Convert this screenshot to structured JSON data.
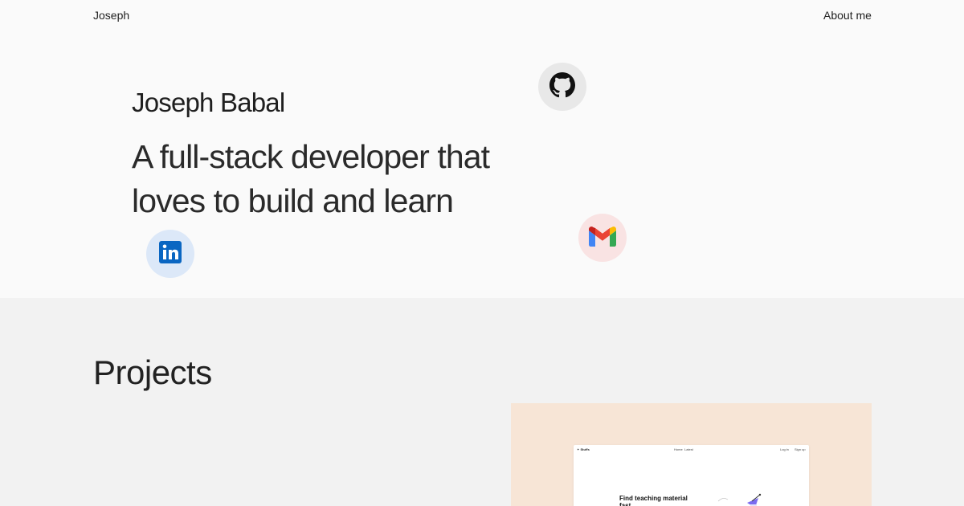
{
  "nav": {
    "brand": "Joseph",
    "about": "About me"
  },
  "hero": {
    "name": "Joseph Babal",
    "tagline": "A full-stack developer that loves to build and learn"
  },
  "social": [
    {
      "name": "github",
      "icon": "github-icon",
      "bg": "#e8e8e8"
    },
    {
      "name": "linkedin",
      "icon": "linkedin-icon",
      "bg": "#dce8f8",
      "color": "#0a66c2"
    },
    {
      "name": "gmail",
      "icon": "gmail-icon",
      "bg": "#f9e3e3"
    }
  ],
  "projects": {
    "title": "Projects",
    "items": [
      {
        "preview_bg": "#f7e5d6",
        "preview": {
          "logo": "✦ Stuffs",
          "nav": [
            "Home",
            "Latest",
            "Log in",
            "Sign up"
          ],
          "heading": "Find teaching material fast"
        }
      }
    ]
  },
  "colors": {
    "hero_bg": "#fafafa",
    "projects_bg": "#f2f2f2",
    "text": "#1f1f1f"
  }
}
